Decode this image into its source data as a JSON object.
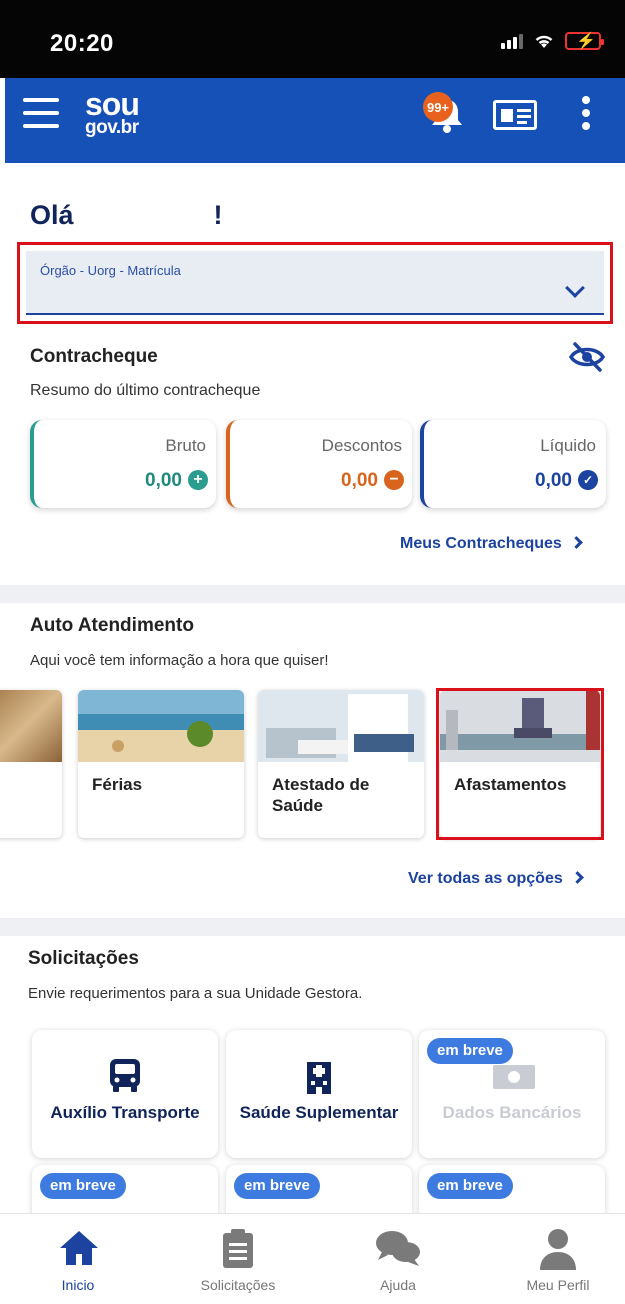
{
  "status_bar": {
    "time": "20:20"
  },
  "header": {
    "logo_line1": "sou",
    "logo_line2": "gov.br",
    "notifications_badge": "99+",
    "brand_color": "#1651b8"
  },
  "greeting": {
    "hello": "Olá",
    "exclamation": "!"
  },
  "org_select": {
    "label": "Órgão - Uorg - Matrícula"
  },
  "payslip": {
    "title": "Contracheque",
    "subtitle": "Resumo do último contracheque",
    "cards": [
      {
        "label": "Bruto",
        "value": "0,00",
        "color": "#2a9d8f",
        "icon": "plus-circle-icon"
      },
      {
        "label": "Descontos",
        "value": "0,00",
        "color": "#d9641d",
        "icon": "minus-circle-icon"
      },
      {
        "label": "Líquido",
        "value": "0,00",
        "color": "#1c43a0",
        "icon": "check-circle-icon"
      }
    ],
    "link": "Meus Contracheques"
  },
  "self_service": {
    "title": "Auto Atendimento",
    "subtitle": "Aqui você tem informação a hora que quiser!",
    "items": [
      {
        "label": "Férias"
      },
      {
        "label": "Atestado de Saúde"
      },
      {
        "label": "Afastamentos"
      }
    ],
    "link": "Ver todas as opções"
  },
  "requests": {
    "title": "Solicitações",
    "subtitle": "Envie requerimentos para a sua Unidade Gestora.",
    "items": [
      {
        "label": "Auxílio Transporte",
        "icon": "bus-icon"
      },
      {
        "label": "Saúde Suplementar",
        "icon": "hospital-icon"
      },
      {
        "label": "Dados Bancários",
        "icon": "money-icon",
        "badge": "em breve"
      }
    ],
    "more_badges": [
      "em breve",
      "em breve",
      "em breve"
    ]
  },
  "bottom_nav": {
    "items": [
      {
        "label": "Inicio",
        "icon": "home-icon",
        "active": true
      },
      {
        "label": "Solicitações",
        "icon": "clipboard-icon"
      },
      {
        "label": "Ajuda",
        "icon": "chat-icon"
      },
      {
        "label": "Meu Perfil",
        "icon": "user-icon"
      }
    ]
  },
  "colors": {
    "highlight": "#d9101a",
    "accent": "#1c43a0"
  }
}
